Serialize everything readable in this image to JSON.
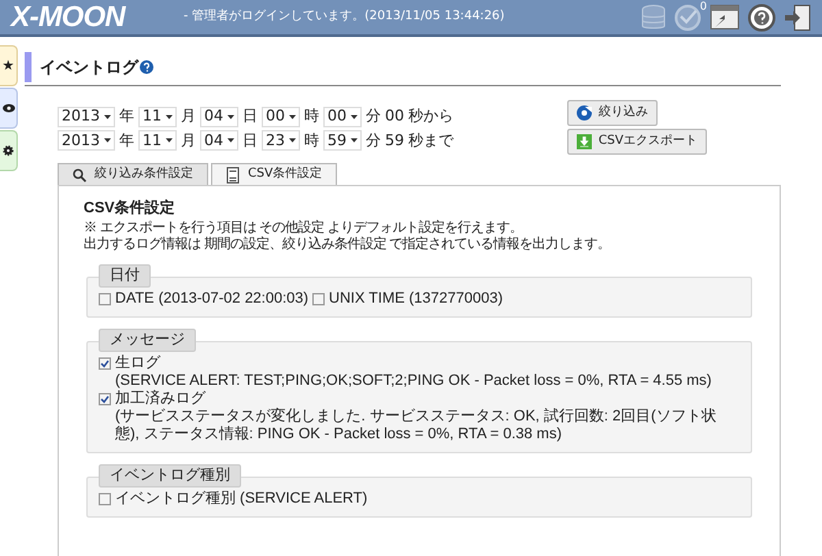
{
  "header": {
    "logo": "X-MOON",
    "login_message": "- 管理者がログインしています。(2013/11/05 13:44:26)",
    "ok_badge": "0"
  },
  "side_tabs": [
    {
      "kind": "star",
      "glyph": "★"
    },
    {
      "kind": "eye"
    },
    {
      "kind": "gear"
    }
  ],
  "page_title": "イベントログ",
  "date_rows": [
    {
      "selects": [
        {
          "value": "2013",
          "unit": "年"
        },
        {
          "value": "11",
          "unit": "月"
        },
        {
          "value": "04",
          "unit": "日"
        },
        {
          "value": "00",
          "unit": "時"
        },
        {
          "value": "00",
          "unit": "分"
        }
      ],
      "seconds": "00",
      "suffix": "秒から"
    },
    {
      "selects": [
        {
          "value": "2013",
          "unit": "年"
        },
        {
          "value": "11",
          "unit": "月"
        },
        {
          "value": "04",
          "unit": "日"
        },
        {
          "value": "23",
          "unit": "時"
        },
        {
          "value": "59",
          "unit": "分"
        }
      ],
      "seconds": "59",
      "suffix": "秒まで"
    }
  ],
  "buttons": [
    {
      "kind": "refresh",
      "label": "絞り込み"
    },
    {
      "kind": "download",
      "label": "CSVエクスポート"
    }
  ],
  "tabs": [
    {
      "kind": "search",
      "label": "絞り込み条件設定",
      "selected": false
    },
    {
      "kind": "csv",
      "label": "CSV条件設定",
      "selected": true
    }
  ],
  "panel": {
    "title": "CSV条件設定",
    "notes": [
      "※ エクスポートを行う項目は その他設定 よりデフォルト設定を行えます。",
      "出力するログ情報は 期間の設定、絞り込み条件設定 で指定されている情報を出力します。"
    ],
    "sections": [
      {
        "kind": "inline",
        "legend": "日付",
        "options": [
          {
            "label": "DATE (2013-07-02 22:00:03)",
            "checked": false
          },
          {
            "label": "UNIX TIME (1372770003)",
            "checked": false
          }
        ]
      },
      {
        "kind": "stacked",
        "legend": "メッセージ",
        "options": [
          {
            "label": "生ログ",
            "detail": "(SERVICE ALERT: TEST;PING;OK;SOFT;2;PING OK - Packet loss = 0%, RTA = 4.55 ms)",
            "checked": true
          },
          {
            "label": "加工済みログ",
            "detail": "(サービスステータスが変化しました. サービスステータス: OK, 試行回数: 2回目(ソフト状態), ステータス情報: PING OK - Packet loss = 0%, RTA = 0.38 ms)",
            "checked": true
          }
        ]
      },
      {
        "kind": "inline",
        "legend": "イベントログ種別",
        "options": [
          {
            "label": "イベントログ種別 (SERVICE ALERT)",
            "checked": false
          }
        ]
      }
    ]
  }
}
